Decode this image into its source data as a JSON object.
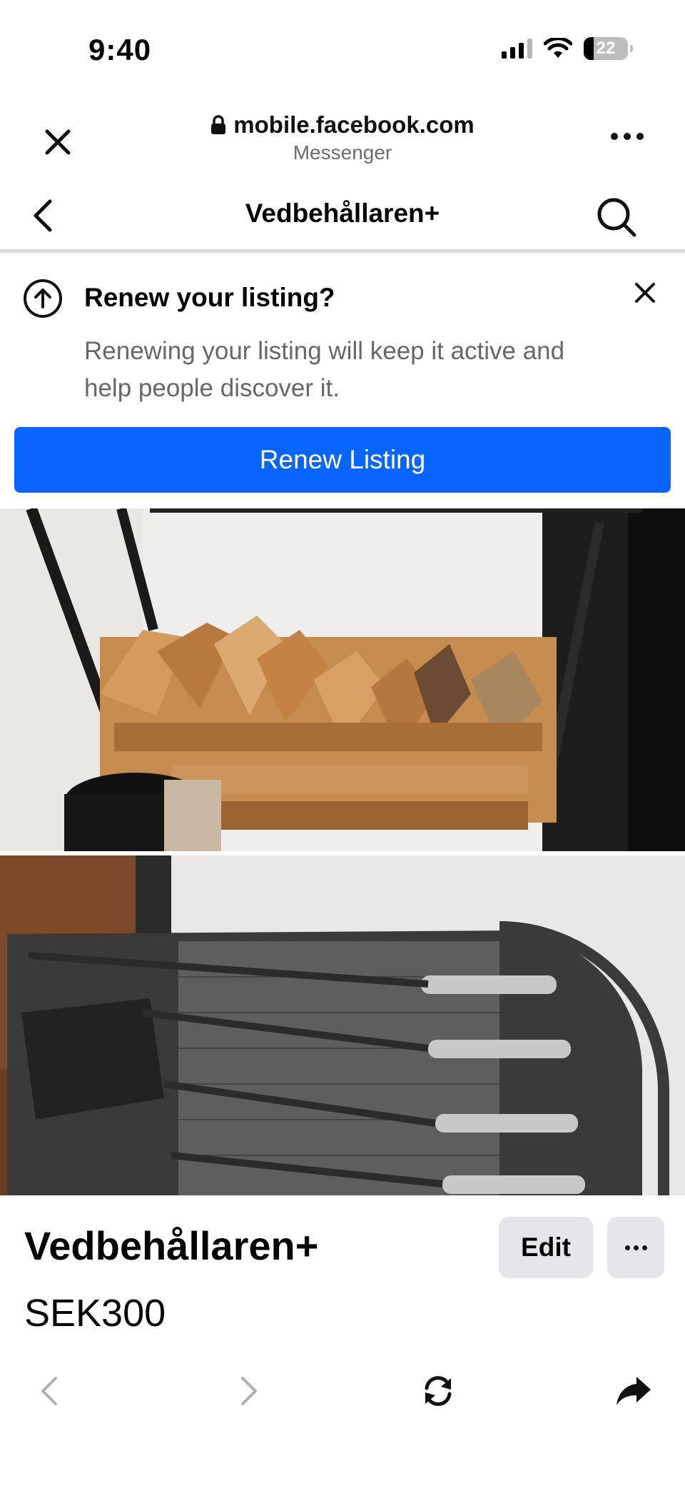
{
  "status_bar": {
    "time": "9:40",
    "battery_percent": "22",
    "battery_level": 0.22,
    "icons": [
      "signal-icon",
      "wifi-icon",
      "battery-icon"
    ]
  },
  "browser": {
    "url": "mobile.facebook.com",
    "subtitle": "Messenger",
    "icons": [
      "close-icon",
      "lock-icon",
      "more-icon"
    ]
  },
  "header": {
    "title": "Vedbehållaren+",
    "icons": [
      "back-icon",
      "search-icon"
    ]
  },
  "renew_banner": {
    "title": "Renew your listing?",
    "description": "Renewing your listing will keep it active and help people discover it.",
    "button_label": "Renew Listing",
    "icons": [
      "upload-arrow-icon",
      "close-icon"
    ],
    "accent_color": "#0866ff"
  },
  "photos": [
    {
      "subject": "firewood-rack-photo"
    },
    {
      "subject": "fireplace-tool-set-photo"
    }
  ],
  "listing": {
    "title": "Vedbehållaren+",
    "price": "SEK300",
    "edit_label": "Edit",
    "more_icon": "ellipsis-icon"
  },
  "toolbar": {
    "icons": [
      "back-arrow-icon",
      "forward-arrow-icon",
      "reload-icon",
      "share-icon"
    ]
  }
}
